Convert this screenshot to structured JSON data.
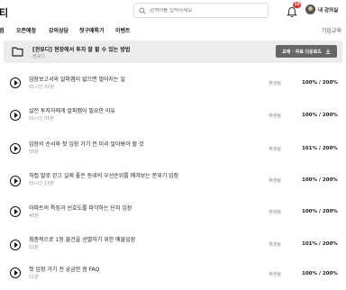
{
  "app": {
    "logo_text": "티"
  },
  "search": {
    "placeholder": "검색어를 입력하세요"
  },
  "notifications": {
    "count": "10"
  },
  "profile": {
    "name": "내 강의실"
  },
  "nav": {
    "items": [
      "렴",
      "오픈예정",
      "강의상담",
      "첫구매특가",
      "이벤트"
    ],
    "right": "기업교육"
  },
  "banner": {
    "title": "[권유디] 현장에서 투자 잘 할 수 있는 방법",
    "subtitle": "권유디",
    "button_label": "교재 · 자료 다운로드"
  },
  "lessons": [
    {
      "title": "임장보고서와 알파맵이 없으면 벌어지는 일",
      "duration": "01시간 02분",
      "action": "재생됨",
      "progress": "100% / 200%"
    },
    {
      "title": "실전 투자자에게 알파맵이 필요한 이유",
      "duration": "01시간 05분",
      "action": "재생됨",
      "progress": "100% / 200%"
    },
    {
      "title": "임장의 순서와 첫 임장 가기 전 미리 알아봐야 할 것",
      "duration": "50분",
      "action": "재생됨",
      "progress": "101% / 200%"
    },
    {
      "title": "직접 발로 걷고 실제 좋은 동네의 우선순위를 매겨보는 분위기 임장",
      "duration": "01시간 15분",
      "action": "재생됨",
      "progress": "100% / 200%"
    },
    {
      "title": "아파트의 특징과 선호도를 파악하는 단지 임장",
      "duration": "46분",
      "action": "재생됨",
      "progress": "100% / 200%"
    },
    {
      "title": "최종적으로 1등 물건을 선별하기 위한 매물임장",
      "duration": "52분",
      "action": "재생됨",
      "progress": "101% / 200%"
    },
    {
      "title": "첫 임장 가기 전 궁금한 점 FAQ",
      "duration": "51분",
      "action": "재생됨",
      "progress": "100% / 200%"
    }
  ]
}
